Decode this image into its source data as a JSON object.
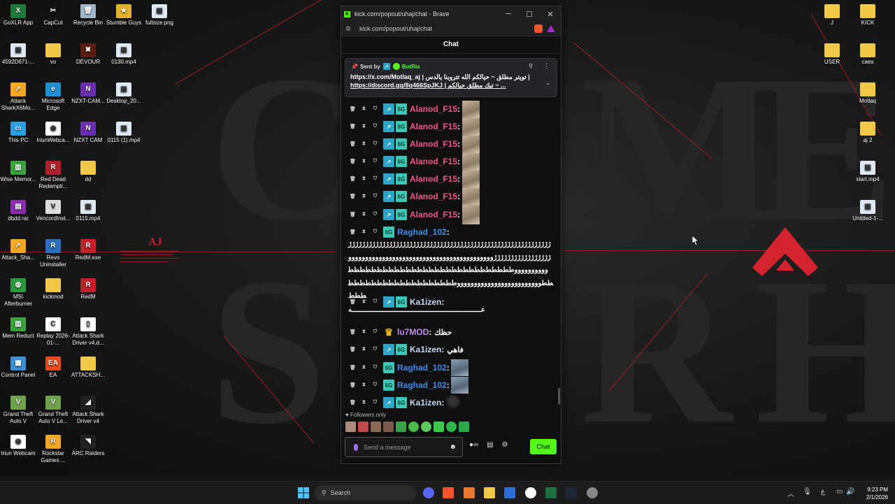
{
  "desktop": {
    "left_icons": [
      {
        "label": "GoXLR App",
        "color": "#1f7a3a",
        "glyph": "X"
      },
      {
        "label": "CapCut",
        "color": "#111111",
        "glyph": "✂"
      },
      {
        "label": "Recycle Bin",
        "color": "#9fb7c9",
        "glyph": "🗑"
      },
      {
        "label": "Stumble Guys",
        "color": "#e2b32a",
        "glyph": "★"
      },
      {
        "label": "fullsize.png",
        "color": "#dfe9f5",
        "glyph": "▣"
      },
      {
        "label": "4592D671-...",
        "color": "#dfe9f5",
        "glyph": "▣"
      },
      {
        "label": "vo",
        "color": "#f2c84b",
        "glyph": ""
      },
      {
        "label": "DEVOUR",
        "color": "#5b1d0c",
        "glyph": "✖"
      },
      {
        "label": "0130.mp4",
        "color": "#dfe9f5",
        "glyph": "▣"
      },
      {
        "label": "Attack SharkX6Mo...",
        "color": "#f5a623",
        "glyph": "➚"
      },
      {
        "label": "Microsoft Edge",
        "color": "#1f8fd2",
        "glyph": "e"
      },
      {
        "label": "NZXT-CAM...",
        "color": "#6a2fb0",
        "glyph": "N"
      },
      {
        "label": "Desktop_20...",
        "color": "#dfe9f5",
        "glyph": "▣"
      },
      {
        "label": "This PC",
        "color": "#2b9fe0",
        "glyph": "▭"
      },
      {
        "label": "IriunWebca...",
        "color": "#ffffff",
        "glyph": "◉"
      },
      {
        "label": "NZXT CAM",
        "color": "#6a2fb0",
        "glyph": "N"
      },
      {
        "label": "0115 (1).mp4",
        "color": "#dfe9f5",
        "glyph": "▣"
      },
      {
        "label": "Wise Memor...",
        "color": "#3aa33e",
        "glyph": "▥"
      },
      {
        "label": "Red Dead Redempti...",
        "color": "#b3202a",
        "glyph": "R"
      },
      {
        "label": "dd",
        "color": "#f2c84b",
        "glyph": ""
      },
      {
        "label": "dbdd.rar",
        "color": "#8c2bb0",
        "glyph": "▤"
      },
      {
        "label": "VencordInst...",
        "color": "#dddddd",
        "glyph": "V"
      },
      {
        "label": "0115.mp4",
        "color": "#dfe9f5",
        "glyph": "▣"
      },
      {
        "label": "Attack_Sha...",
        "color": "#f5a623",
        "glyph": "➚"
      },
      {
        "label": "Revo Uninstaller",
        "color": "#2c6ebd",
        "glyph": "R"
      },
      {
        "label": "RedM.exe",
        "color": "#c61f2a",
        "glyph": "R"
      },
      {
        "label": "MSI Afterburner",
        "color": "#2a9a3c",
        "glyph": "◍"
      },
      {
        "label": "kickmod",
        "color": "#f2c84b",
        "glyph": ""
      },
      {
        "label": "RedM",
        "color": "#c61f2a",
        "glyph": "R"
      },
      {
        "label": "Mem Reduct",
        "color": "#3aa33e",
        "glyph": "▥"
      },
      {
        "label": "Replay 2026-01-...",
        "color": "#ffffff",
        "glyph": "C"
      },
      {
        "label": "Attack Shark Driver v4.d...",
        "color": "#ffffff",
        "glyph": "▯"
      },
      {
        "label": "Control Panel",
        "color": "#3d8fd6",
        "glyph": "▦"
      },
      {
        "label": "EA",
        "color": "#e84b1a",
        "glyph": "EA"
      },
      {
        "label": "ATTACKSH...",
        "color": "#f2c84b",
        "glyph": ""
      },
      {
        "label": "Grand Theft Auto V",
        "color": "#6da34a",
        "glyph": "V"
      },
      {
        "label": "Grand Theft Auto V Le...",
        "color": "#6da34a",
        "glyph": "V"
      },
      {
        "label": "Attack Shark Driver v4",
        "color": "#222222",
        "glyph": "◢"
      },
      {
        "label": "Iriun Webcam",
        "color": "#ffffff",
        "glyph": "◉"
      },
      {
        "label": "Rockstar Games ...",
        "color": "#f5a623",
        "glyph": "R"
      },
      {
        "label": "ARC Raiders",
        "color": "#222222",
        "glyph": "◥"
      }
    ],
    "right_icons": [
      {
        "label": "J",
        "color": "#f2c84b",
        "glyph": ""
      },
      {
        "label": "KICK",
        "color": "#f2c84b",
        "glyph": ""
      },
      {
        "label": "USER",
        "color": "#f2c84b",
        "glyph": ""
      },
      {
        "label": "caes",
        "color": "#f2c84b",
        "glyph": ""
      },
      {
        "label": "Motlaq",
        "color": "#f2c84b",
        "glyph": ""
      },
      {
        "label": "aj 2",
        "color": "#f2c84b",
        "glyph": ""
      },
      {
        "label": "start.mp4",
        "color": "#dfe9f5",
        "glyph": "▣"
      },
      {
        "label": "Untitled-1-...",
        "color": "#dfe9f5",
        "glyph": "▣"
      }
    ],
    "wall_logo": {
      "title": "AJ"
    }
  },
  "browser": {
    "title": "kick.com/popout/uhaj/chat - Brave",
    "url": "kick.com/popout/uhaj/chat",
    "min": "─",
    "max": "☐",
    "close": "✕"
  },
  "chat": {
    "header": "Chat",
    "pinned": {
      "sent_by": "Sent by",
      "bot": "BotRix",
      "line1": "https://x.com/Motlaq_aj | تويتر مطلق ~ حيالكم الله تتروبنا يالدس |",
      "line2": "https://discord.gg/8q466SpJKJ | تيك مطلق حيالكم ~ ..."
    },
    "messages": [
      {
        "user": "Alanod_F15",
        "text": "",
        "color": "#f0588b",
        "emote": "photo"
      },
      {
        "user": "Alanod_F15",
        "text": "",
        "color": "#f0588b",
        "emote": "photo"
      },
      {
        "user": "Alanod_F15",
        "text": "",
        "color": "#f0588b",
        "emote": "photo"
      },
      {
        "user": "Alanod_F15",
        "text": "",
        "color": "#f0588b",
        "emote": "photo"
      },
      {
        "user": "Alanod_F15",
        "text": "",
        "color": "#f0588b",
        "emote": "photo"
      },
      {
        "user": "Alanod_F15",
        "text": "",
        "color": "#f0588b",
        "emote": "photo"
      },
      {
        "user": "Alanod_F15",
        "text": "",
        "color": "#f0588b",
        "emote": "photo"
      },
      {
        "user": "Raghad_102",
        "text": "",
        "color": "#3f8ee8",
        "emote": ""
      },
      {
        "user": "Ka1izen",
        "text": "",
        "color": "#c5d8f5",
        "emote": ""
      },
      {
        "user": "lu7MOD",
        "text": "حظك",
        "color": "#c38bf0",
        "emote": ""
      },
      {
        "user": "Ka1izen",
        "text": "فاهي",
        "color": "#c5d8f5",
        "emote": ""
      },
      {
        "user": "Raghad_102",
        "text": "",
        "color": "#3f8ee8",
        "emote": "photo2"
      },
      {
        "user": "Raghad_102",
        "text": "",
        "color": "#3f8ee8",
        "emote": "photo2"
      },
      {
        "user": "Ka1izen",
        "text": "",
        "color": "#c5d8f5",
        "emote": "dark"
      }
    ],
    "raghad_long": "ژژژژژژژژژژژژژژژژژژژژژژژژژژژژژژژژژژژژژژژژژژژژژژژژژژژژژژژژژژژژژژژژژژژژژژژژژژژژژوووووووووووووووووووووووووووووووووووووووووووووووووووووطططططططططططططططططططططططططططططططوووووووووووووووووووووووووطططططططططططططططططططططط",
    "kalizen_long": "ع‍ـــــــــــــــــــــــــــــــــــــــــــــــــــــــــــــــه",
    "followers_only": "Followers only",
    "send_placeholder": "Send a message",
    "chat_button": "Chat"
  },
  "taskbar": {
    "search": "Search",
    "time": "9:23 PM",
    "date": "2/1/2026",
    "lang": "ع"
  }
}
